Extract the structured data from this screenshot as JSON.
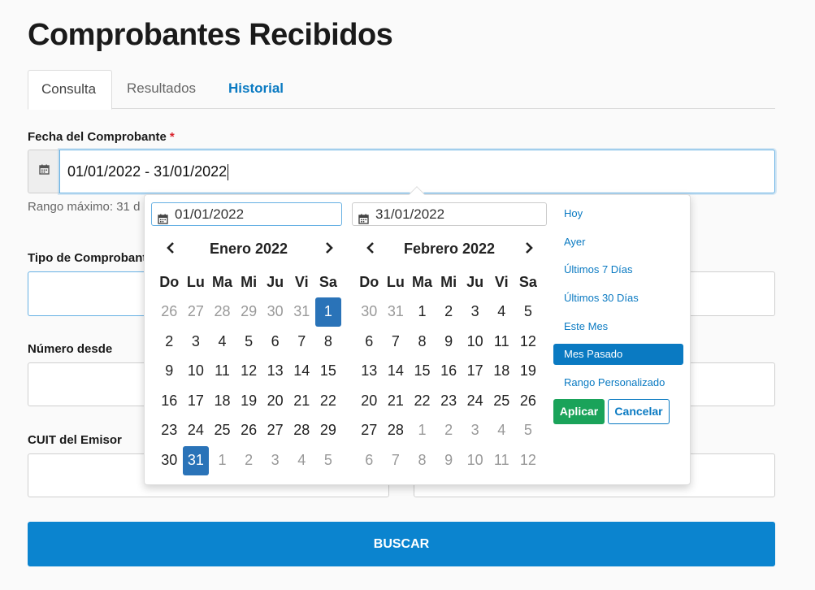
{
  "page": {
    "title": "Comprobantes Recibidos"
  },
  "tabs": [
    {
      "label": "Consulta"
    },
    {
      "label": "Resultados"
    },
    {
      "label": "Historial"
    }
  ],
  "form": {
    "fecha_label": "Fecha del Comprobante",
    "required_mark": "*",
    "fecha_value": "01/01/2022 - 31/01/2022",
    "fecha_hint": "Rango máximo: 31 d",
    "tipo_label": "Tipo de Comprobante",
    "numero_label": "Número desde",
    "cuit_label": "CUIT del Emisor",
    "search_button": "BUSCAR"
  },
  "picker": {
    "start_input": "01/01/2022",
    "end_input": "31/01/2022",
    "weekdays": [
      "Do",
      "Lu",
      "Ma",
      "Mi",
      "Ju",
      "Vi",
      "Sa"
    ],
    "left_month": {
      "title": "Enero 2022",
      "weeks": [
        [
          "26",
          "27",
          "28",
          "29",
          "30",
          "31",
          "1"
        ],
        [
          "2",
          "3",
          "4",
          "5",
          "6",
          "7",
          "8"
        ],
        [
          "9",
          "10",
          "11",
          "12",
          "13",
          "14",
          "15"
        ],
        [
          "16",
          "17",
          "18",
          "19",
          "20",
          "21",
          "22"
        ],
        [
          "23",
          "24",
          "25",
          "26",
          "27",
          "28",
          "29"
        ],
        [
          "30",
          "31",
          "1",
          "2",
          "3",
          "4",
          "5"
        ]
      ],
      "off_days": [
        [
          0,
          0
        ],
        [
          0,
          1
        ],
        [
          0,
          2
        ],
        [
          0,
          3
        ],
        [
          0,
          4
        ],
        [
          0,
          5
        ],
        [
          5,
          2
        ],
        [
          5,
          3
        ],
        [
          5,
          4
        ],
        [
          5,
          5
        ],
        [
          5,
          6
        ]
      ],
      "selected_days": [
        [
          0,
          6
        ],
        [
          5,
          1
        ]
      ]
    },
    "right_month": {
      "title": "Febrero 2022",
      "weeks": [
        [
          "30",
          "31",
          "1",
          "2",
          "3",
          "4",
          "5"
        ],
        [
          "6",
          "7",
          "8",
          "9",
          "10",
          "11",
          "12"
        ],
        [
          "13",
          "14",
          "15",
          "16",
          "17",
          "18",
          "19"
        ],
        [
          "20",
          "21",
          "22",
          "23",
          "24",
          "25",
          "26"
        ],
        [
          "27",
          "28",
          "1",
          "2",
          "3",
          "4",
          "5"
        ],
        [
          "6",
          "7",
          "8",
          "9",
          "10",
          "11",
          "12"
        ]
      ],
      "off_days": [
        [
          0,
          0
        ],
        [
          0,
          1
        ],
        [
          4,
          2
        ],
        [
          4,
          3
        ],
        [
          4,
          4
        ],
        [
          4,
          5
        ],
        [
          4,
          6
        ],
        [
          5,
          0
        ],
        [
          5,
          1
        ],
        [
          5,
          2
        ],
        [
          5,
          3
        ],
        [
          5,
          4
        ],
        [
          5,
          5
        ],
        [
          5,
          6
        ]
      ],
      "selected_days": []
    },
    "ranges": [
      {
        "label": "Hoy",
        "active": false
      },
      {
        "label": "Ayer",
        "active": false
      },
      {
        "label": "Últimos 7 Días",
        "active": false
      },
      {
        "label": "Últimos 30 Días",
        "active": false
      },
      {
        "label": "Este Mes",
        "active": false
      },
      {
        "label": "Mes Pasado",
        "active": true
      },
      {
        "label": "Rango Personalizado",
        "active": false
      }
    ],
    "apply_label": "Aplicar",
    "cancel_label": "Cancelar"
  },
  "colors": {
    "accent": "#0b84cf",
    "selected_day": "#2a73b8",
    "apply": "#1aa35a",
    "required": "#d9232d"
  },
  "icons": {
    "calendar": "calendar-icon",
    "prev": "chevron-left-icon",
    "next": "chevron-right-icon"
  }
}
